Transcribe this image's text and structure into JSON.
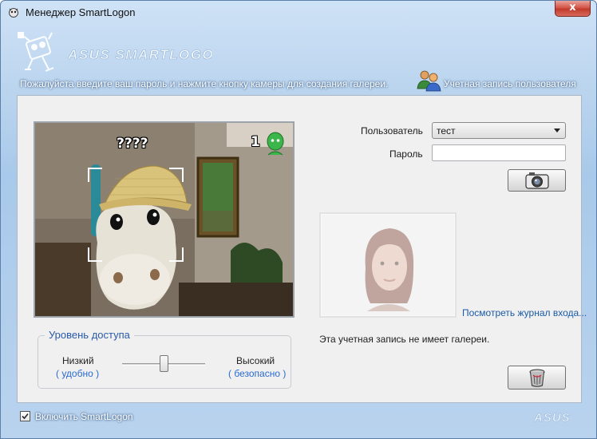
{
  "window": {
    "title": "Менеджер SmartLogon",
    "close_glyph": "x"
  },
  "header": {
    "brand_text": "ASUS SMARTLOGON",
    "instruction": "Пожалуйста введите ваш пароль и нажмите кнопку камеры для создания галереи.",
    "account_label": "Учетная запись пользователя"
  },
  "webcam": {
    "face_label": "????",
    "face_count": "1"
  },
  "access": {
    "title": "Уровень доступа",
    "low_label": "Низкий",
    "low_sub": "( удобно )",
    "high_label": "Высокий",
    "high_sub": "( безопасно )",
    "slider_value": 0.5
  },
  "login": {
    "user_label": "Пользователь",
    "user_value": "тест",
    "password_label": "Пароль",
    "password_value": ""
  },
  "gallery": {
    "view_log_link": "Посмотреть журнал входа...",
    "status_text": "Эта учетная запись не имеет галереи."
  },
  "footer": {
    "enable_label": "Включить SmartLogon",
    "enable_checked": true,
    "asus_text": "ASUS"
  },
  "colors": {
    "accent_blue": "#2a5aa8",
    "face_indicator_green": "#3cb54a",
    "close_red": "#c13b2c"
  },
  "icons": [
    "app-icon",
    "robot-logo-icon",
    "users-icon",
    "face-indicator-icon",
    "camera-icon",
    "trash-icon",
    "checkmark-icon"
  ]
}
